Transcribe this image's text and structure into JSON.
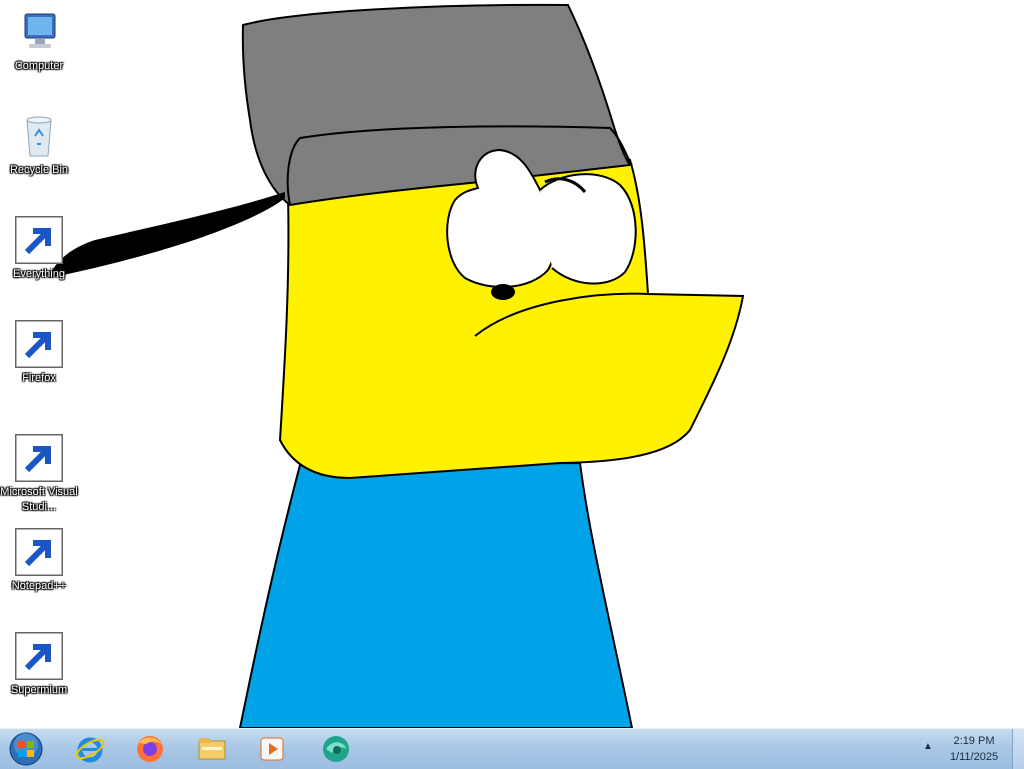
{
  "desktop": {
    "icons": [
      {
        "label": "Computer",
        "icon": "computer-icon",
        "shortcut": false
      },
      {
        "label": "Recycle Bin",
        "icon": "recycle-bin-icon",
        "shortcut": false
      },
      {
        "label": "Everything",
        "icon": "everything-search-icon",
        "shortcut": true
      },
      {
        "label": "Firefox",
        "icon": "firefox-icon",
        "shortcut": true
      },
      {
        "label": "Microsoft Visual Studi...",
        "icon": "visual-studio-icon",
        "shortcut": true
      },
      {
        "label": "Notepad++",
        "icon": "notepad-plus-plus-icon",
        "shortcut": true
      },
      {
        "label": "Supermium",
        "icon": "supermium-icon",
        "shortcut": true
      }
    ],
    "wallpaper": "cartoon-character-drawing"
  },
  "taskbar": {
    "start": "windows-start-orb-icon",
    "pinned": [
      "internet-explorer-icon",
      "firefox-icon",
      "file-explorer-icon",
      "media-player-icon",
      "supermium-icon"
    ],
    "tray_arrow": "▲",
    "clock": {
      "time": "2:19 PM",
      "date": "1/11/2025"
    }
  },
  "colors": {
    "hat": "#7f7f7f",
    "face": "#fff200",
    "shirt": "#00a2e8",
    "taskbar": "#aac8e6"
  }
}
